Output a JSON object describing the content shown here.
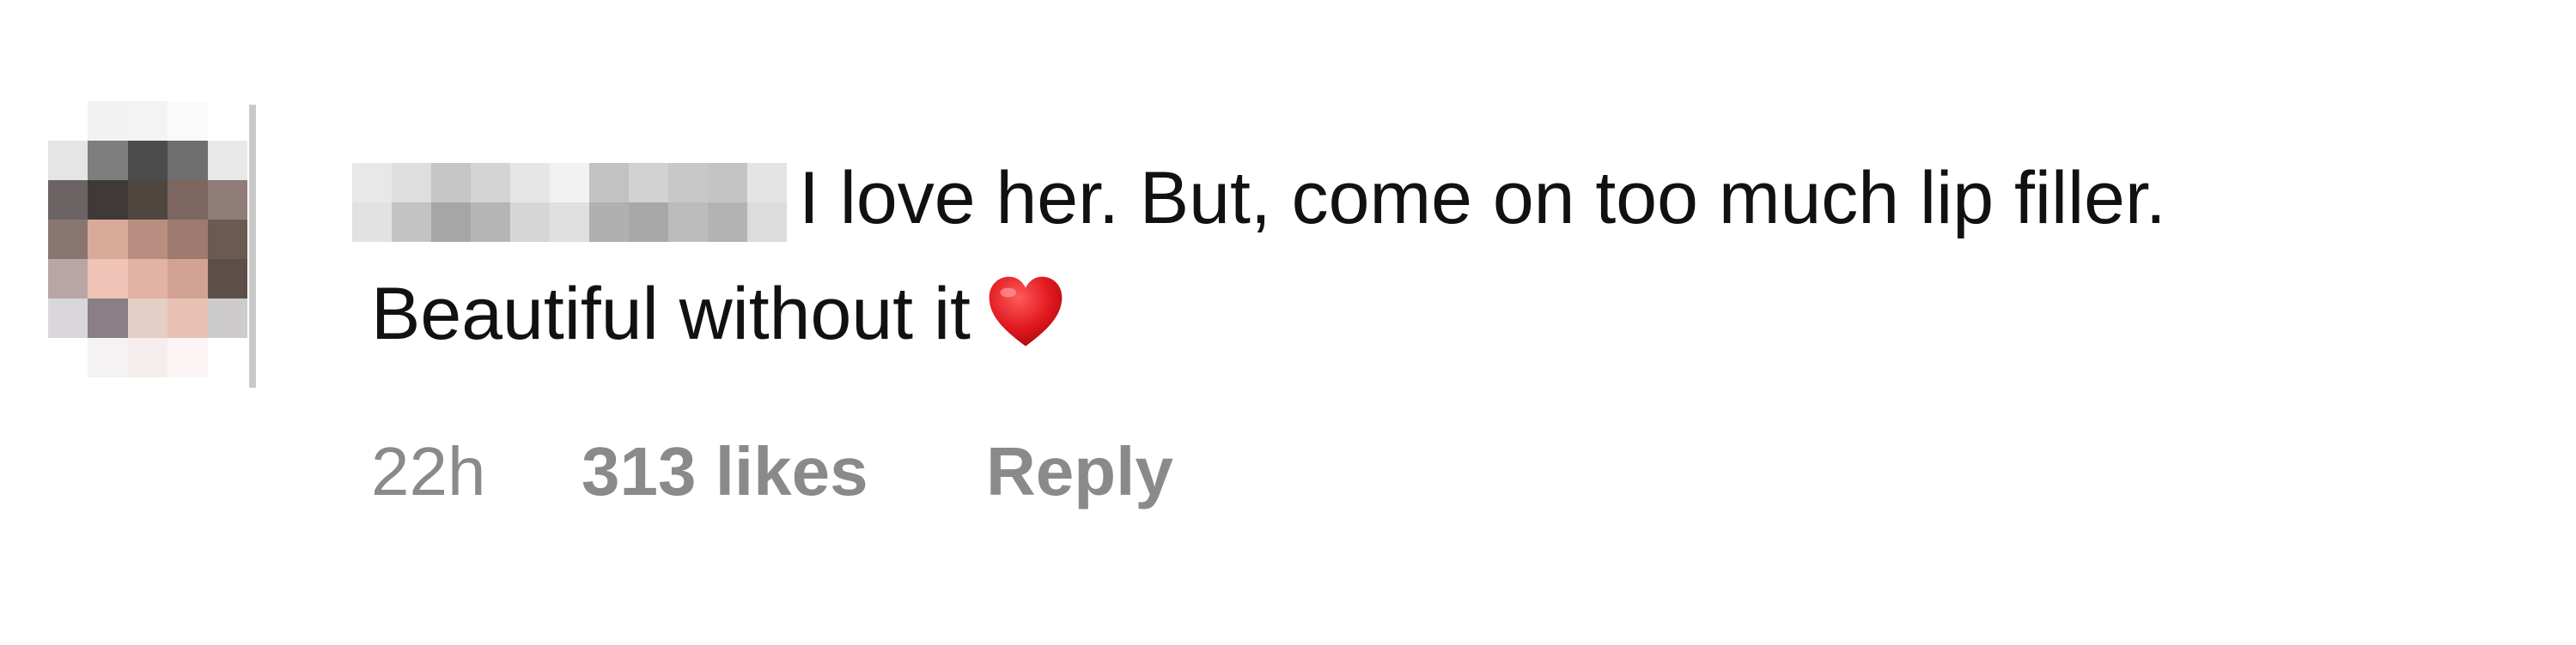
{
  "comment": {
    "text_line1": "I love her. But, come on too much lip filler.",
    "text_line2": "Beautiful without it",
    "emoji": "heart-emoji",
    "timestamp": "22h",
    "likes": "313 likes",
    "reply_label": "Reply"
  },
  "colors": {
    "text": "#111111",
    "meta": "#8a8a8a",
    "heart": "#e0181f"
  }
}
